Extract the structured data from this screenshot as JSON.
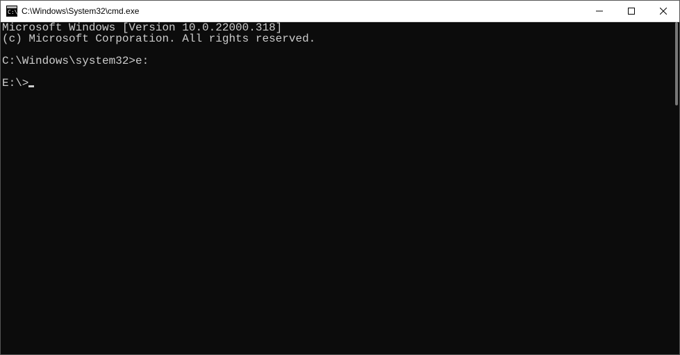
{
  "window": {
    "title": "C:\\Windows\\System32\\cmd.exe"
  },
  "terminal": {
    "lines": [
      "Microsoft Windows [Version 10.0.22000.318]",
      "(c) Microsoft Corporation. All rights reserved.",
      "",
      "C:\\Windows\\system32>e:",
      ""
    ],
    "current_prompt": "E:\\>"
  }
}
